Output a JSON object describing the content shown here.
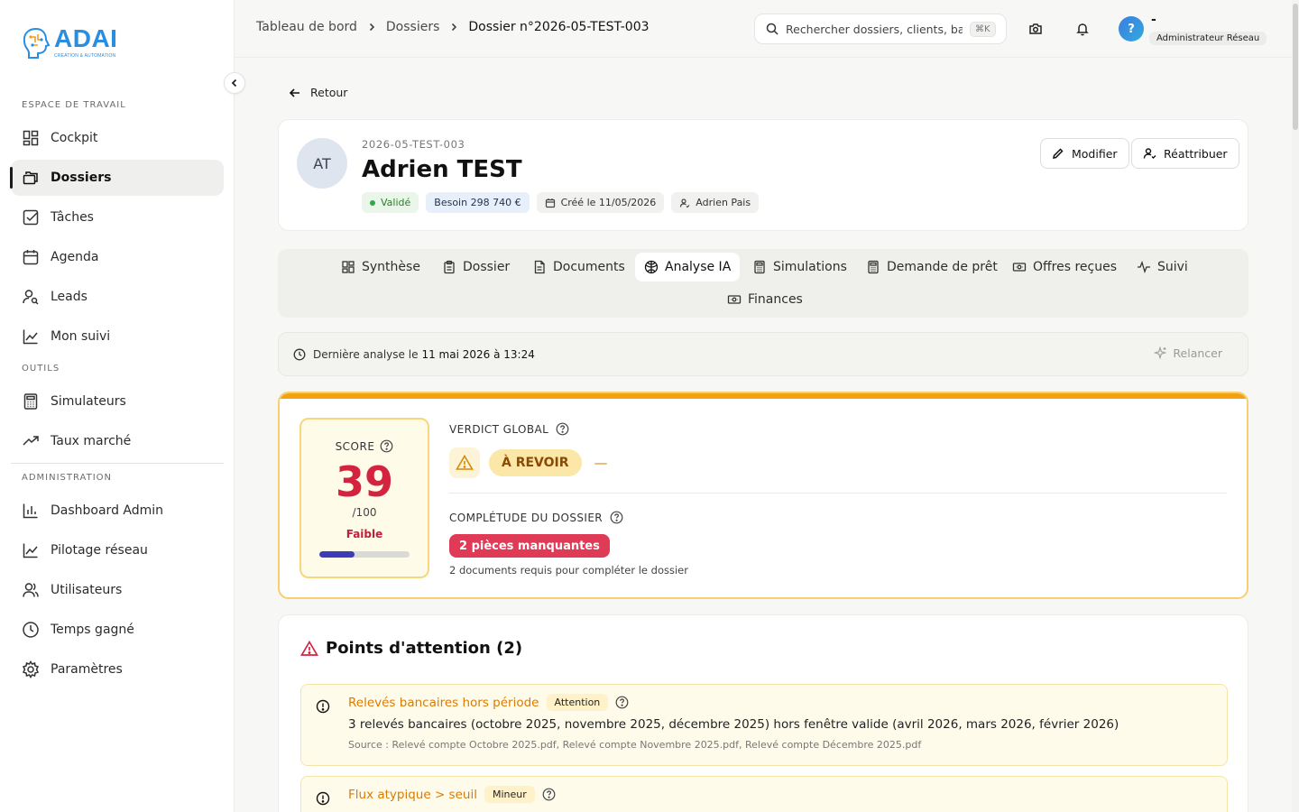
{
  "brand": {
    "name": "ADAI",
    "tagline": "CREATION & AUTOMATION"
  },
  "sidebar": {
    "sections": [
      {
        "label": "ESPACE DE TRAVAIL"
      },
      {
        "label": "OUTILS"
      },
      {
        "label": "ADMINISTRATION"
      }
    ],
    "items": [
      {
        "label": "Cockpit",
        "icon": "dashboard-icon"
      },
      {
        "label": "Dossiers",
        "icon": "folders-icon",
        "active": true
      },
      {
        "label": "Tâches",
        "icon": "checkbox-icon"
      },
      {
        "label": "Agenda",
        "icon": "calendar-icon"
      },
      {
        "label": "Leads",
        "icon": "user-search-icon"
      },
      {
        "label": "Mon suivi",
        "icon": "line-chart-icon"
      },
      {
        "label": "Simulateurs",
        "icon": "calculator-icon"
      },
      {
        "label": "Taux marché",
        "icon": "trending-up-icon"
      },
      {
        "label": "Dashboard Admin",
        "icon": "bar-chart-icon"
      },
      {
        "label": "Pilotage réseau",
        "icon": "line-chart-icon"
      },
      {
        "label": "Utilisateurs",
        "icon": "users-icon"
      },
      {
        "label": "Temps gagné",
        "icon": "clock-icon"
      },
      {
        "label": "Paramètres",
        "icon": "gear-icon"
      }
    ]
  },
  "topbar": {
    "breadcrumb": [
      "Tableau de bord",
      "Dossiers",
      "Dossier n°2026-05-TEST-003"
    ],
    "search_placeholder": "Rechercher dossiers, clients, ba...",
    "search_shortcut": "⌘K",
    "user": {
      "initial": "?",
      "name": "-",
      "role": "Administrateur Réseau"
    }
  },
  "back_label": "Retour",
  "client": {
    "initials": "AT",
    "reference": "2026-05-TEST-003",
    "name": "Adrien TEST",
    "status": "Validé",
    "need": "Besoin 298 740 €",
    "created": "Créé le 11/05/2026",
    "advisor": "Adrien Pais",
    "edit_label": "Modifier",
    "reassign_label": "Réattribuer"
  },
  "tabs": [
    {
      "label": "Synthèse",
      "icon": "grid-icon"
    },
    {
      "label": "Dossier",
      "icon": "clipboard-icon"
    },
    {
      "label": "Documents",
      "icon": "file-icon"
    },
    {
      "label": "Analyse IA",
      "icon": "brain-icon",
      "active": true
    },
    {
      "label": "Simulations",
      "icon": "calculator-icon"
    },
    {
      "label": "Demande de prêt",
      "icon": "calculator-icon"
    },
    {
      "label": "Offres reçues",
      "icon": "banknote-icon"
    },
    {
      "label": "Suivi",
      "icon": "activity-icon"
    },
    {
      "label": "Finances",
      "icon": "banknote-icon"
    }
  ],
  "analysis": {
    "last_label": "Dernière analyse le",
    "last_date": "11 mai 2026 à 13:24",
    "rerun_label": "Relancer"
  },
  "score": {
    "label": "SCORE",
    "value": "39",
    "max": "/100",
    "quality": "Faible",
    "fraction": 0.39
  },
  "verdict": {
    "title": "VERDICT GLOBAL",
    "value": "À REVOIR",
    "extra": "—"
  },
  "completeness": {
    "title": "COMPLÉTUDE DU DOSSIER",
    "missing": "2 pièces manquantes",
    "description": "2 documents requis pour compléter le dossier"
  },
  "attention": {
    "title": "Points d'attention (2)",
    "items": [
      {
        "name": "Relevés bancaires hors période",
        "badge": "Attention",
        "text": "3 relevés bancaires (octobre 2025, novembre 2025, décembre 2025) hors fenêtre valide (avril 2026, mars 2026, février 2026)",
        "source": "Source : Relevé compte Octobre 2025.pdf, Relevé compte Novembre 2025.pdf, Relevé compte Décembre 2025.pdf"
      },
      {
        "name": "Flux atypique > seuil",
        "badge": "Mineur",
        "text": "",
        "source": ""
      }
    ]
  },
  "colors": {
    "accent_orange": "#f2a20e",
    "score_red": "#d4233f",
    "brand_blue": "#2a8ee0"
  }
}
